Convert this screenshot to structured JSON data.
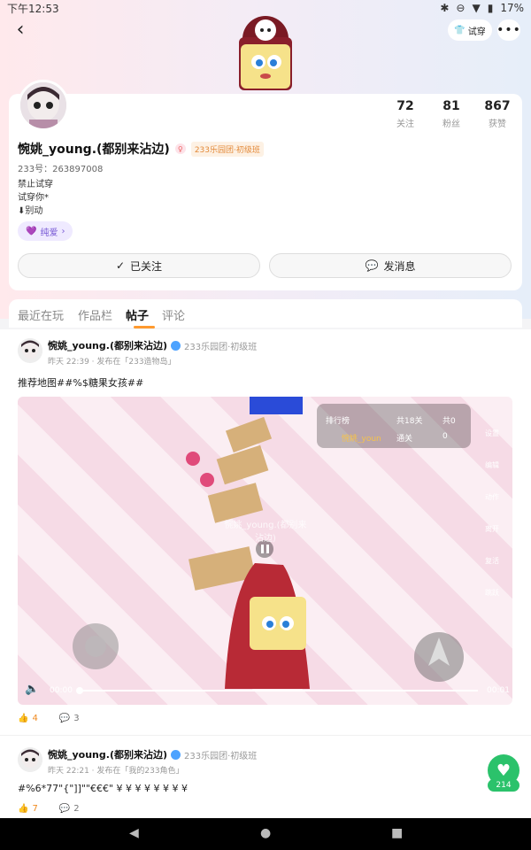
{
  "status": {
    "time": "下午12:53",
    "battery": "17%"
  },
  "topbar": {
    "tryon_label": "试穿"
  },
  "profile": {
    "stats": [
      {
        "num": "72",
        "label": "关注"
      },
      {
        "num": "81",
        "label": "粉丝"
      },
      {
        "num": "867",
        "label": "获赞"
      }
    ],
    "name": "惋姚_young.(都别来沾边)",
    "group_badge": "233乐园团·初级班",
    "uid": "233号：263897008",
    "bio": [
      "禁止试穿",
      "试穿你*",
      "⬇别动"
    ],
    "tag": "纯爱",
    "followed_label": "已关注",
    "message_label": "发消息"
  },
  "tabs": [
    "最近在玩",
    "作品栏",
    "帖子",
    "评论"
  ],
  "posts": [
    {
      "name": "惋姚_young.(都别来沾边)",
      "group": "233乐园团·初级班",
      "time": "昨天 22:39 · 发布在「233造物岛」",
      "text": "推荐地图##%$糖果女孩##",
      "video": {
        "rank_title": "排行榜",
        "levels": "共18关",
        "coins": "共0",
        "player": "惋姚_youn",
        "passed": "通关",
        "score": "0",
        "watermark": "惋姚_young.(都别来沾边)",
        "time_start": "00:00",
        "time_end": "00:01",
        "side_buttons": [
          "设置",
          "编辑",
          "动作",
          "离开",
          "复活",
          "跳跃"
        ]
      },
      "likes": "4",
      "comments": "3"
    },
    {
      "name": "惋姚_young.(都别来沾边)",
      "group": "233乐园团·初级班",
      "time": "昨天 22:21 · 发布在「我的233角色」",
      "text": "#%6*77\"{\"]]\"\"€€€\" ¥ ¥ ¥ ¥ ¥ ¥ ¥ ¥",
      "likes": "7",
      "comments": "2"
    }
  ],
  "float_like": {
    "count": "214"
  },
  "colors": {
    "accent": "#ff9a2e",
    "like": "#f08a1f",
    "green": "#2bc26b"
  }
}
